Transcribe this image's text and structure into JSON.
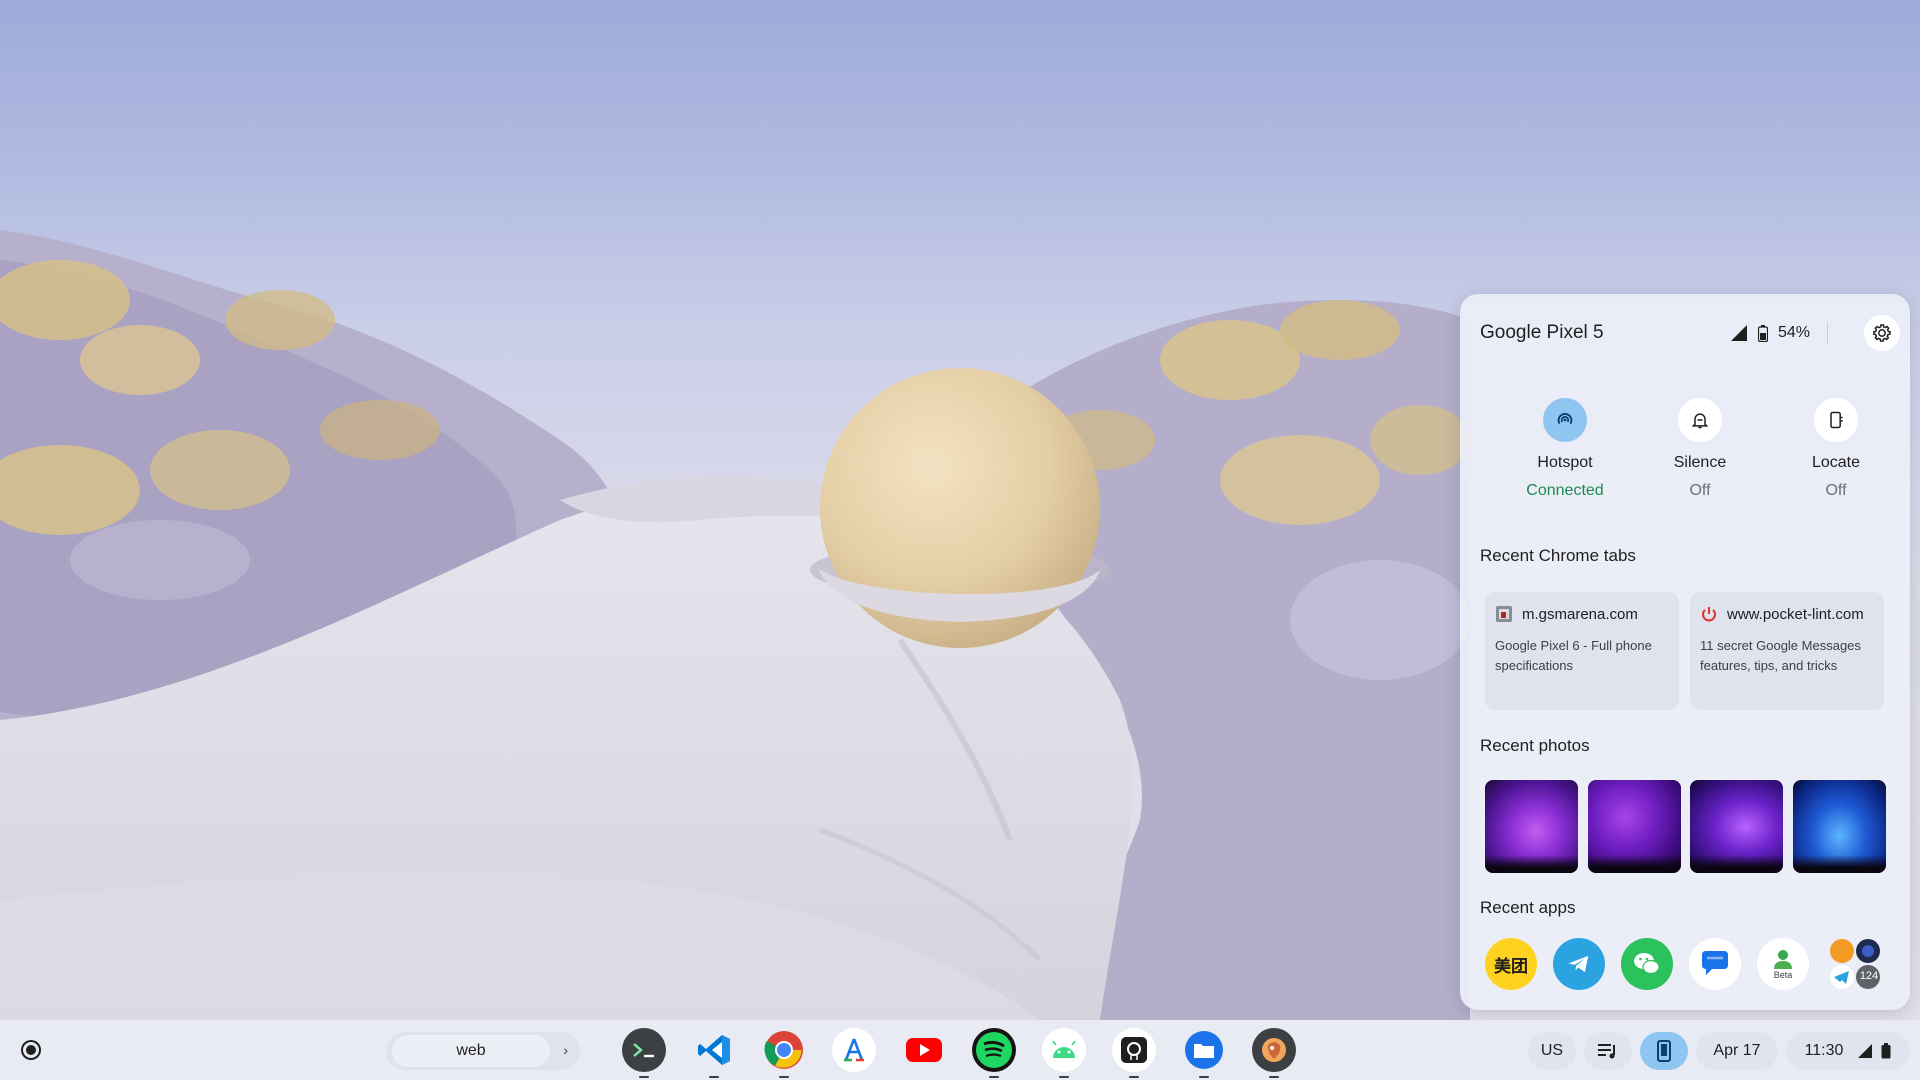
{
  "phone_hub": {
    "device_name": "Google Pixel 5",
    "battery_percent": "54%",
    "features": [
      {
        "label": "Hotspot",
        "state": "Connected",
        "icon": "hotspot-icon",
        "active": true
      },
      {
        "label": "Silence",
        "state": "Off",
        "icon": "silence-bell-icon",
        "active": false
      },
      {
        "label": "Locate",
        "state": "Off",
        "icon": "locate-phone-icon",
        "active": false
      }
    ],
    "recent_tabs_title": "Recent Chrome tabs",
    "recent_tabs": [
      {
        "site": "m.gsmarena.com",
        "title": "Google Pixel 6 - Full phone specifications",
        "icon": "gsmarena-favicon"
      },
      {
        "site": "www.pocket-lint.com",
        "title": "11 secret Google Messages features, tips, and tricks",
        "icon": "pocket-lint-power-favicon"
      }
    ],
    "recent_photos_title": "Recent photos",
    "recent_apps_title": "Recent apps",
    "recent_apps": [
      {
        "name": "meituan-app-icon",
        "text": "美团"
      },
      {
        "name": "telegram-app-icon"
      },
      {
        "name": "wechat-app-icon"
      },
      {
        "name": "google-messages-app-icon"
      },
      {
        "name": "beta-app-icon",
        "text": "Beta"
      },
      {
        "name": "more-apps-icon",
        "text": "124"
      }
    ]
  },
  "shelf": {
    "desk_name": "web",
    "apps": [
      "terminal-app-icon",
      "vscode-app-icon",
      "chrome-app-icon",
      "app-store-app-icon",
      "youtube-app-icon",
      "spotify-app-icon",
      "android-app-icon",
      "github-app-icon",
      "files-app-icon",
      "custom-app-icon"
    ],
    "ime": "US",
    "date": "Apr 17",
    "time": "11:30"
  },
  "colors": {
    "accent": "#8ec6f1",
    "connected": "#1b8a52"
  }
}
